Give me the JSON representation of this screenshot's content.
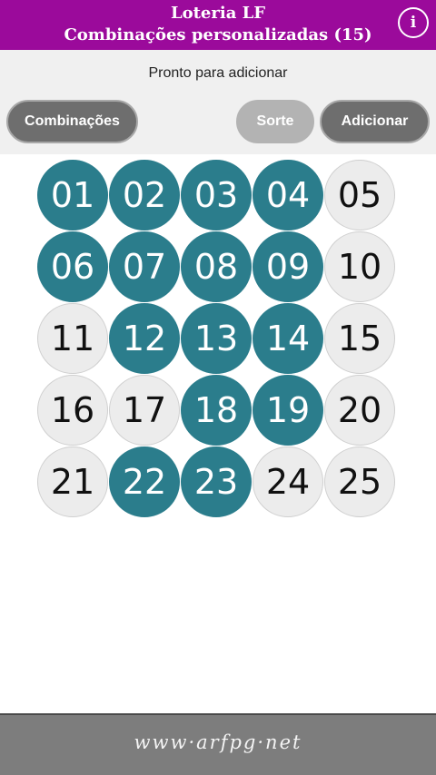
{
  "header": {
    "title": "Loteria LF",
    "subtitle": "Combinações personalizadas (15)",
    "info_glyph": "i"
  },
  "status": "Pronto para adicionar",
  "buttons": {
    "combinacoes": "Combinações",
    "sorte": "Sorte",
    "adicionar": "Adicionar"
  },
  "numbers": [
    {
      "label": "01",
      "selected": true
    },
    {
      "label": "02",
      "selected": true
    },
    {
      "label": "03",
      "selected": true
    },
    {
      "label": "04",
      "selected": true
    },
    {
      "label": "05",
      "selected": false
    },
    {
      "label": "06",
      "selected": true
    },
    {
      "label": "07",
      "selected": true
    },
    {
      "label": "08",
      "selected": true
    },
    {
      "label": "09",
      "selected": true
    },
    {
      "label": "10",
      "selected": false
    },
    {
      "label": "11",
      "selected": false
    },
    {
      "label": "12",
      "selected": true
    },
    {
      "label": "13",
      "selected": true
    },
    {
      "label": "14",
      "selected": true
    },
    {
      "label": "15",
      "selected": false
    },
    {
      "label": "16",
      "selected": false
    },
    {
      "label": "17",
      "selected": false
    },
    {
      "label": "18",
      "selected": true
    },
    {
      "label": "19",
      "selected": true
    },
    {
      "label": "20",
      "selected": false
    },
    {
      "label": "21",
      "selected": false
    },
    {
      "label": "22",
      "selected": true
    },
    {
      "label": "23",
      "selected": true
    },
    {
      "label": "24",
      "selected": false
    },
    {
      "label": "25",
      "selected": false
    }
  ],
  "footer": "www·arfpg·net",
  "colors": {
    "header_bg": "#9b0a9b",
    "selected_ball": "#2b7d8c",
    "unselected_ball": "#ececec"
  }
}
